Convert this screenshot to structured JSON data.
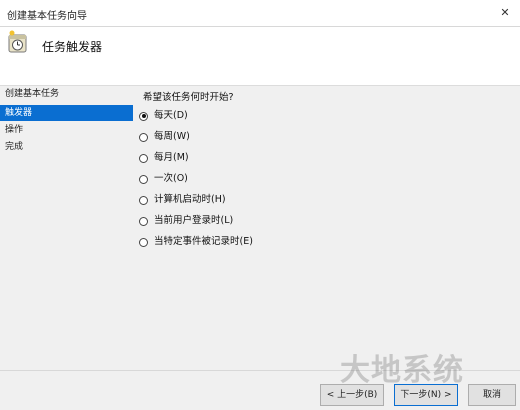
{
  "window": {
    "title": "创建基本任务向导",
    "close_glyph": "✕"
  },
  "header": {
    "title": "任务触发器",
    "icon": "task-clock-icon"
  },
  "sidebar": {
    "items": [
      {
        "label": "创建基本任务",
        "selected": false
      },
      {
        "label": "触发器",
        "selected": true
      },
      {
        "label": "操作",
        "selected": false
      },
      {
        "label": "完成",
        "selected": false
      }
    ]
  },
  "main": {
    "question": "希望该任务何时开始?",
    "options": [
      {
        "label": "每天(D)",
        "checked": true
      },
      {
        "label": "每周(W)",
        "checked": false
      },
      {
        "label": "每月(M)",
        "checked": false
      },
      {
        "label": "一次(O)",
        "checked": false
      },
      {
        "label": "计算机启动时(H)",
        "checked": false
      },
      {
        "label": "当前用户登录时(L)",
        "checked": false
      },
      {
        "label": "当特定事件被记录时(E)",
        "checked": false
      }
    ]
  },
  "footer": {
    "back_label": "< 上一步(B)",
    "next_label": "下一步(N) >",
    "cancel_label": "取消"
  },
  "watermark": "大地系统",
  "colors": {
    "accent": "#0a6ed1"
  }
}
